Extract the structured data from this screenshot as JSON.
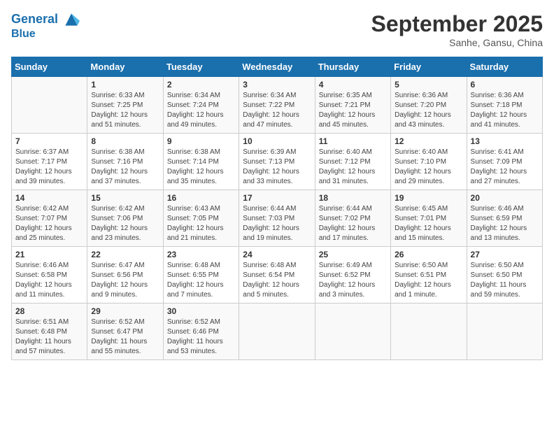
{
  "header": {
    "logo_line1": "General",
    "logo_line2": "Blue",
    "month": "September 2025",
    "location": "Sanhe, Gansu, China"
  },
  "days_of_week": [
    "Sunday",
    "Monday",
    "Tuesday",
    "Wednesday",
    "Thursday",
    "Friday",
    "Saturday"
  ],
  "weeks": [
    [
      {
        "day": "",
        "info": ""
      },
      {
        "day": "1",
        "info": "Sunrise: 6:33 AM\nSunset: 7:25 PM\nDaylight: 12 hours\nand 51 minutes."
      },
      {
        "day": "2",
        "info": "Sunrise: 6:34 AM\nSunset: 7:24 PM\nDaylight: 12 hours\nand 49 minutes."
      },
      {
        "day": "3",
        "info": "Sunrise: 6:34 AM\nSunset: 7:22 PM\nDaylight: 12 hours\nand 47 minutes."
      },
      {
        "day": "4",
        "info": "Sunrise: 6:35 AM\nSunset: 7:21 PM\nDaylight: 12 hours\nand 45 minutes."
      },
      {
        "day": "5",
        "info": "Sunrise: 6:36 AM\nSunset: 7:20 PM\nDaylight: 12 hours\nand 43 minutes."
      },
      {
        "day": "6",
        "info": "Sunrise: 6:36 AM\nSunset: 7:18 PM\nDaylight: 12 hours\nand 41 minutes."
      }
    ],
    [
      {
        "day": "7",
        "info": "Sunrise: 6:37 AM\nSunset: 7:17 PM\nDaylight: 12 hours\nand 39 minutes."
      },
      {
        "day": "8",
        "info": "Sunrise: 6:38 AM\nSunset: 7:16 PM\nDaylight: 12 hours\nand 37 minutes."
      },
      {
        "day": "9",
        "info": "Sunrise: 6:38 AM\nSunset: 7:14 PM\nDaylight: 12 hours\nand 35 minutes."
      },
      {
        "day": "10",
        "info": "Sunrise: 6:39 AM\nSunset: 7:13 PM\nDaylight: 12 hours\nand 33 minutes."
      },
      {
        "day": "11",
        "info": "Sunrise: 6:40 AM\nSunset: 7:12 PM\nDaylight: 12 hours\nand 31 minutes."
      },
      {
        "day": "12",
        "info": "Sunrise: 6:40 AM\nSunset: 7:10 PM\nDaylight: 12 hours\nand 29 minutes."
      },
      {
        "day": "13",
        "info": "Sunrise: 6:41 AM\nSunset: 7:09 PM\nDaylight: 12 hours\nand 27 minutes."
      }
    ],
    [
      {
        "day": "14",
        "info": "Sunrise: 6:42 AM\nSunset: 7:07 PM\nDaylight: 12 hours\nand 25 minutes."
      },
      {
        "day": "15",
        "info": "Sunrise: 6:42 AM\nSunset: 7:06 PM\nDaylight: 12 hours\nand 23 minutes."
      },
      {
        "day": "16",
        "info": "Sunrise: 6:43 AM\nSunset: 7:05 PM\nDaylight: 12 hours\nand 21 minutes."
      },
      {
        "day": "17",
        "info": "Sunrise: 6:44 AM\nSunset: 7:03 PM\nDaylight: 12 hours\nand 19 minutes."
      },
      {
        "day": "18",
        "info": "Sunrise: 6:44 AM\nSunset: 7:02 PM\nDaylight: 12 hours\nand 17 minutes."
      },
      {
        "day": "19",
        "info": "Sunrise: 6:45 AM\nSunset: 7:01 PM\nDaylight: 12 hours\nand 15 minutes."
      },
      {
        "day": "20",
        "info": "Sunrise: 6:46 AM\nSunset: 6:59 PM\nDaylight: 12 hours\nand 13 minutes."
      }
    ],
    [
      {
        "day": "21",
        "info": "Sunrise: 6:46 AM\nSunset: 6:58 PM\nDaylight: 12 hours\nand 11 minutes."
      },
      {
        "day": "22",
        "info": "Sunrise: 6:47 AM\nSunset: 6:56 PM\nDaylight: 12 hours\nand 9 minutes."
      },
      {
        "day": "23",
        "info": "Sunrise: 6:48 AM\nSunset: 6:55 PM\nDaylight: 12 hours\nand 7 minutes."
      },
      {
        "day": "24",
        "info": "Sunrise: 6:48 AM\nSunset: 6:54 PM\nDaylight: 12 hours\nand 5 minutes."
      },
      {
        "day": "25",
        "info": "Sunrise: 6:49 AM\nSunset: 6:52 PM\nDaylight: 12 hours\nand 3 minutes."
      },
      {
        "day": "26",
        "info": "Sunrise: 6:50 AM\nSunset: 6:51 PM\nDaylight: 12 hours\nand 1 minute."
      },
      {
        "day": "27",
        "info": "Sunrise: 6:50 AM\nSunset: 6:50 PM\nDaylight: 11 hours\nand 59 minutes."
      }
    ],
    [
      {
        "day": "28",
        "info": "Sunrise: 6:51 AM\nSunset: 6:48 PM\nDaylight: 11 hours\nand 57 minutes."
      },
      {
        "day": "29",
        "info": "Sunrise: 6:52 AM\nSunset: 6:47 PM\nDaylight: 11 hours\nand 55 minutes."
      },
      {
        "day": "30",
        "info": "Sunrise: 6:52 AM\nSunset: 6:46 PM\nDaylight: 11 hours\nand 53 minutes."
      },
      {
        "day": "",
        "info": ""
      },
      {
        "day": "",
        "info": ""
      },
      {
        "day": "",
        "info": ""
      },
      {
        "day": "",
        "info": ""
      }
    ]
  ]
}
